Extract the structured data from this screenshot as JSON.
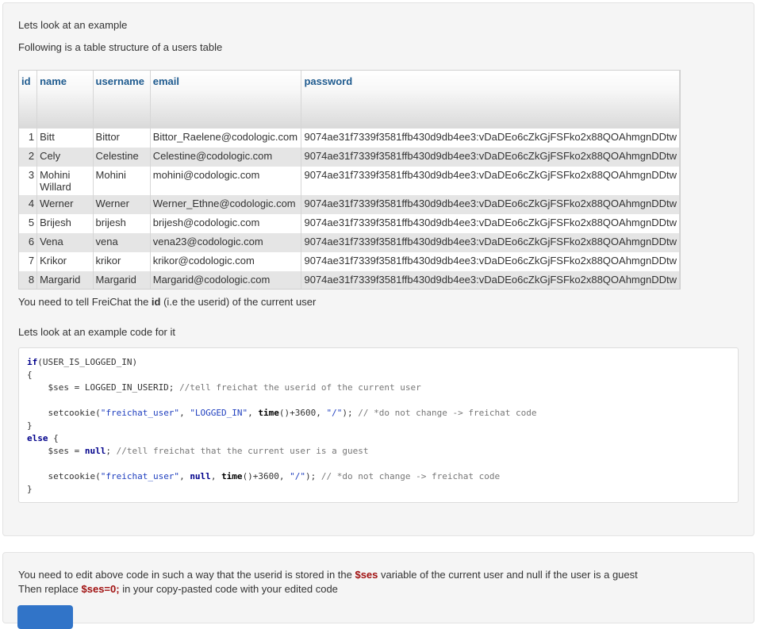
{
  "intro": {
    "line1": "Lets look at an example",
    "line2": "Following is a table structure of a users table"
  },
  "table": {
    "headers": [
      "id",
      "name",
      "username",
      "email",
      "password"
    ],
    "rows": [
      {
        "id": "1",
        "name": "Bitt",
        "username": "Bittor",
        "email": "Bittor_Raelene@codologic.com",
        "password": "9074ae31f7339f3581ffb430d9db4ee3:vDaDEo6cZkGjFSFko2x88QOAhmgnDDtw"
      },
      {
        "id": "2",
        "name": "Cely",
        "username": "Celestine",
        "email": "Celestine@codologic.com",
        "password": "9074ae31f7339f3581ffb430d9db4ee3:vDaDEo6cZkGjFSFko2x88QOAhmgnDDtw"
      },
      {
        "id": "3",
        "name": "Mohini Willard",
        "username": "Mohini",
        "email": "mohini@codologic.com",
        "password": "9074ae31f7339f3581ffb430d9db4ee3:vDaDEo6cZkGjFSFko2x88QOAhmgnDDtw"
      },
      {
        "id": "4",
        "name": "Werner",
        "username": "Werner",
        "email": "Werner_Ethne@codologic.com",
        "password": "9074ae31f7339f3581ffb430d9db4ee3:vDaDEo6cZkGjFSFko2x88QOAhmgnDDtw"
      },
      {
        "id": "5",
        "name": "Brijesh",
        "username": "brijesh",
        "email": "brijesh@codologic.com",
        "password": "9074ae31f7339f3581ffb430d9db4ee3:vDaDEo6cZkGjFSFko2x88QOAhmgnDDtw"
      },
      {
        "id": "6",
        "name": "Vena",
        "username": "vena",
        "email": "vena23@codologic.com",
        "password": "9074ae31f7339f3581ffb430d9db4ee3:vDaDEo6cZkGjFSFko2x88QOAhmgnDDtw"
      },
      {
        "id": "7",
        "name": "Krikor",
        "username": "krikor",
        "email": "krikor@codologic.com",
        "password": "9074ae31f7339f3581ffb430d9db4ee3:vDaDEo6cZkGjFSFko2x88QOAhmgnDDtw"
      },
      {
        "id": "8",
        "name": "Margarid",
        "username": "Margarid",
        "email": "Margarid@codologic.com",
        "password": "9074ae31f7339f3581ffb430d9db4ee3:vDaDEo6cZkGjFSFko2x88QOAhmgnDDtw"
      }
    ]
  },
  "tell": {
    "before": "You need to tell FreiChat the ",
    "bold": "id",
    "after": " (i.e the userid) of the current user"
  },
  "example2": "Lets look at an example code for it",
  "code": {
    "l1_kw": "if",
    "l1_rest": "(USER_IS_LOGGED_IN)",
    "l2": "{",
    "l3_a": "    $ses = LOGGED_IN_USERID; ",
    "l3_cm": "//tell freichat the userid of the current user",
    "l5_a": "    setcookie(",
    "l5_s1": "\"freichat_user\"",
    "l5_b": ", ",
    "l5_s2": "\"LOGGED_IN\"",
    "l5_c": ", ",
    "l5_fn": "time",
    "l5_d": "()+3600, ",
    "l5_s3": "\"/\"",
    "l5_e": "); ",
    "l5_cm": "// *do not change -> freichat code",
    "l6": "}",
    "l7_kw": "else",
    "l7_rest": " {",
    "l8_a": "    $ses = ",
    "l8_kw": "null",
    "l8_b": "; ",
    "l8_cm": "//tell freichat that the current user is a guest",
    "l10_a": "    setcookie(",
    "l10_s1": "\"freichat_user\"",
    "l10_b": ", ",
    "l10_kw": "null",
    "l10_c": ", ",
    "l10_fn": "time",
    "l10_d": "()+3600, ",
    "l10_s2": "\"/\"",
    "l10_e": "); ",
    "l10_cm": "// *do not change -> freichat code",
    "l11": "}"
  },
  "instructions": {
    "line1_before": "You need to edit above code in such a way that the userid is stored in the ",
    "line1_var": "$ses",
    "line1_after": " variable of the current user and null if the user is a guest",
    "line2_before": "Then replace ",
    "line2_var": "$ses=0;",
    "line2_after": " in your copy-pasted code with your edited code"
  },
  "colors": {
    "header_text": "#1f5b8f",
    "highlight_red": "#a01010",
    "button_blue": "#3174c8"
  }
}
